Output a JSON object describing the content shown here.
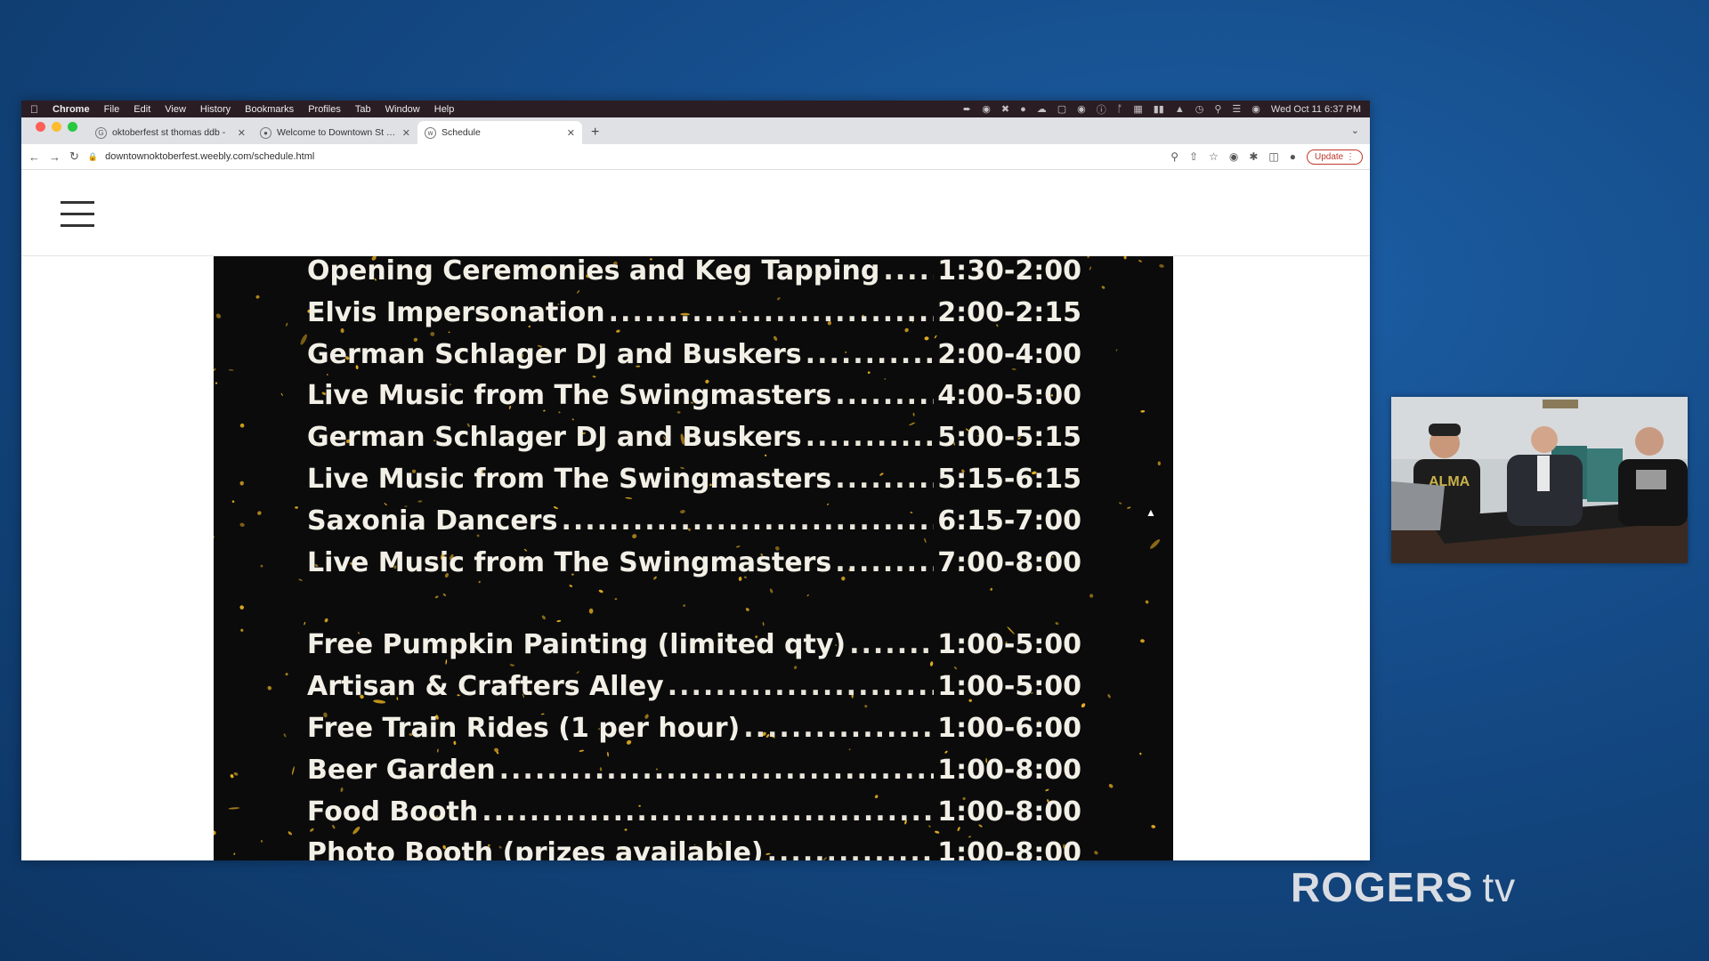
{
  "menubar": {
    "app": "Chrome",
    "menus": [
      "File",
      "Edit",
      "View",
      "History",
      "Bookmarks",
      "Profiles",
      "Tab",
      "Window",
      "Help"
    ],
    "clock": "Wed Oct 11  6:37 PM"
  },
  "tabs": [
    {
      "title": "oktoberfest st thomas ddb - ",
      "icon": "google-icon",
      "active": false
    },
    {
      "title": "Welcome to Downtown St Th",
      "icon": "globe-icon",
      "active": false
    },
    {
      "title": "Schedule",
      "icon": "weebly-icon",
      "active": true
    }
  ],
  "toolbar": {
    "url": "downtownoktoberfest.weebly.com/schedule.html",
    "update_label": "Update"
  },
  "schedule": {
    "main_events": [
      {
        "event": "Opening Ceremonies and Keg Tapping",
        "time": "1:30-2:00"
      },
      {
        "event": "Elvis Impersonation",
        "time": "2:00-2:15"
      },
      {
        "event": "German Schlager DJ and Buskers",
        "time": "2:00-4:00"
      },
      {
        "event": "Live Music from The Swingmasters",
        "time": "4:00-5:00"
      },
      {
        "event": "German Schlager DJ and Buskers",
        "time": "5:00-5:15"
      },
      {
        "event": "Live Music from The Swingmasters",
        "time": "5:15-6:15"
      },
      {
        "event": "Saxonia Dancers",
        "time": "6:15-7:00"
      },
      {
        "event": "Live Music from The Swingmasters",
        "time": "7:00-8:00"
      }
    ],
    "activities": [
      {
        "event": "Free Pumpkin Painting (limited qty)",
        "time": "1:00-5:00"
      },
      {
        "event": "Artisan & Crafters Alley",
        "time": "1:00-5:00"
      },
      {
        "event": "Free Train Rides (1 per hour)",
        "time": "1:00-6:00"
      },
      {
        "event": "Beer Garden",
        "time": "1:00-8:00"
      },
      {
        "event": "Food Booth",
        "time": "1:00-8:00"
      },
      {
        "event": "Photo Booth (prizes available)",
        "time": "1:00-8:00"
      }
    ]
  },
  "overlay": {
    "logo_brand": "ROGERS",
    "logo_suffix": "tv",
    "webcam_shirt_text": "ALMA"
  },
  "colors": {
    "accent_gold": "#e8b020",
    "background_blue": "#144a86"
  }
}
